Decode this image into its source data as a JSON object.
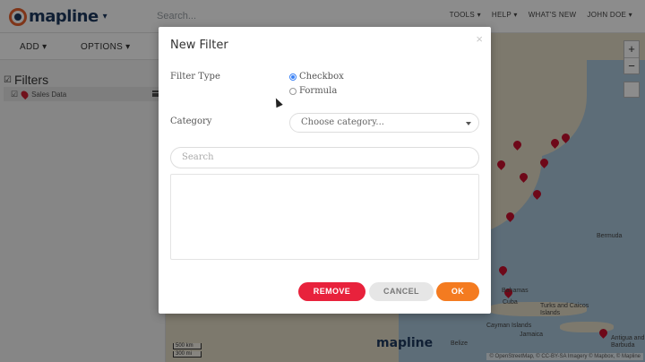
{
  "app": {
    "logo_text": "mapline",
    "search_placeholder": "Search...",
    "nav": [
      "TOOLS ▾",
      "HELP ▾",
      "WHAT'S NEW",
      "JOHN DOE ▾"
    ]
  },
  "toolbar": {
    "add_label": "ADD ▾",
    "options_label": "OPTIONS ▾"
  },
  "sidebar": {
    "title": "Filters",
    "items": [
      {
        "label": "Sales Data"
      }
    ]
  },
  "map": {
    "labels": [
      "Bermuda",
      "Bahamas",
      "Cuba",
      "Turks and Caicos Islands",
      "Cayman Islands",
      "Jamaica",
      "Belize",
      "Antigua and Barbuda"
    ],
    "scale": [
      "500 km",
      "300 mi"
    ],
    "attribution": "© OpenStreetMap, © CC-BY-SA Imagery © Mapbox, © Mapline"
  },
  "modal": {
    "title": "New Filter",
    "close_label": "×",
    "filter_type_label": "Filter Type",
    "filter_type_options": [
      {
        "label": "Checkbox",
        "selected": true
      },
      {
        "label": "Formula",
        "selected": false
      }
    ],
    "category_label": "Category",
    "category_placeholder": "Choose category...",
    "search_placeholder": "Search",
    "buttons": {
      "remove": "REMOVE",
      "cancel": "CANCEL",
      "ok": "OK"
    }
  },
  "colors": {
    "remove": "#e8223c",
    "ok": "#f47b20",
    "brand": "#1e3a5f",
    "accent": "#e8622e"
  }
}
